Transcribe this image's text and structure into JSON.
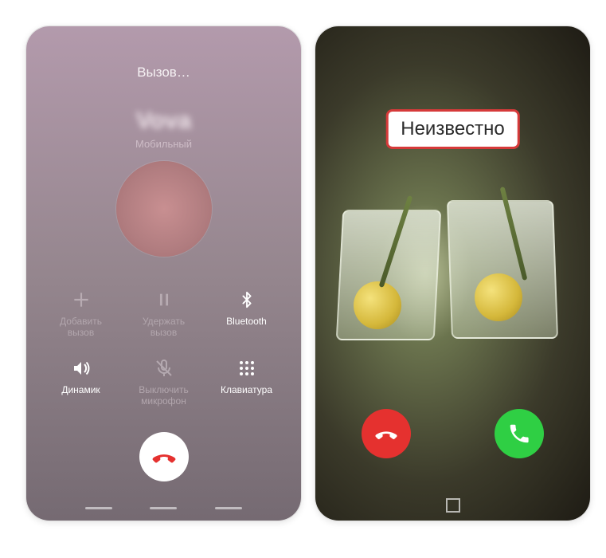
{
  "left": {
    "status": "Вызов…",
    "caller_name": "Vova",
    "caller_type": "Мобильный",
    "buttons": {
      "add": {
        "label": "Добавить\nвызов"
      },
      "hold": {
        "label": "Удержать\nвызов"
      },
      "bt": {
        "label": "Bluetooth"
      },
      "speaker": {
        "label": "Динамик"
      },
      "mute": {
        "label": "Выключить\nмикрофон"
      },
      "keypad": {
        "label": "Клавиатура"
      }
    }
  },
  "right": {
    "caller": "Неизвестно"
  },
  "colors": {
    "decline": "#e5312f",
    "accept": "#2fcf44"
  }
}
